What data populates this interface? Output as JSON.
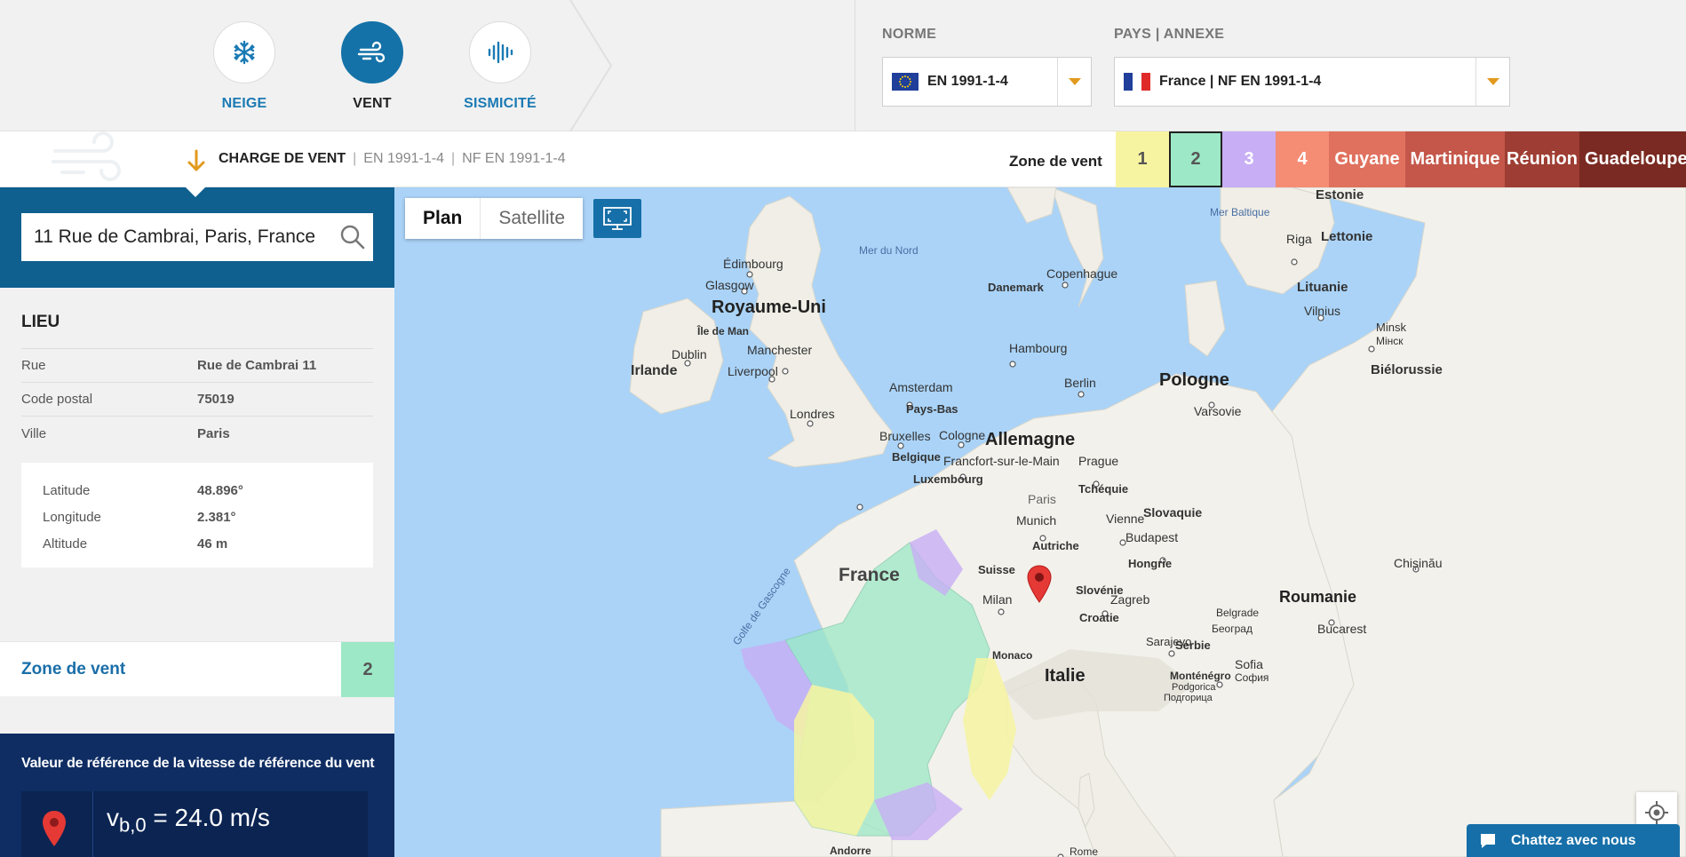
{
  "nav": {
    "loads": [
      {
        "label": "NEIGE",
        "icon": "snowflake-icon",
        "active": false
      },
      {
        "label": "VENT",
        "icon": "wind-icon",
        "active": true
      },
      {
        "label": "SISMICITÉ",
        "icon": "seismic-icon",
        "active": false
      }
    ]
  },
  "selectors": {
    "norme_label": "NORME",
    "norme_value": "EN 1991-1-4",
    "pays_label": "PAYS | ANNEXE",
    "pays_value": "France | NF EN 1991-1-4"
  },
  "breadcrumb": {
    "title": "CHARGE DE VENT",
    "separator": "|",
    "norm": "EN 1991-1-4",
    "annex": "NF EN 1991-1-4"
  },
  "zones": {
    "label": "Zone de vent",
    "selected": "2",
    "items": [
      {
        "label": "1",
        "color": "#f7f4a1",
        "text_color": "#555555"
      },
      {
        "label": "2",
        "color": "#9de8c6",
        "text_color": "#555555"
      },
      {
        "label": "3",
        "color": "#c7aef5",
        "text_color": "#ffffff"
      },
      {
        "label": "4",
        "color": "#f58c74",
        "text_color": "#ffffff"
      },
      {
        "label": "Guyane",
        "color": "#e0715e",
        "text_color": "#ffffff"
      },
      {
        "label": "Martinique",
        "color": "#c4574a",
        "text_color": "#ffffff"
      },
      {
        "label": "Réunion",
        "color": "#9e3d33",
        "text_color": "#ffffff"
      },
      {
        "label": "Guadeloupe",
        "color": "#7a2a22",
        "text_color": "#ffffff"
      }
    ]
  },
  "search": {
    "value": "11 Rue de Cambrai, Paris, France"
  },
  "lieu": {
    "title": "LIEU",
    "rows": [
      {
        "key": "Rue",
        "value": "Rue de Cambrai 11"
      },
      {
        "key": "Code postal",
        "value": "75019"
      },
      {
        "key": "Ville",
        "value": "Paris"
      }
    ],
    "coords": [
      {
        "key": "Latitude",
        "value": "48.896°"
      },
      {
        "key": "Longitude",
        "value": "2.381°"
      },
      {
        "key": "Altitude",
        "value": "46 m"
      }
    ]
  },
  "zone_result": {
    "label": "Zone de vent",
    "value": "2"
  },
  "reference": {
    "title": "Valeur de référence de la vitesse de référence du vent",
    "symbol": "v",
    "subscript": "b,0",
    "equals": "= 24.0 m/s"
  },
  "map": {
    "tabs": [
      "Plan",
      "Satellite"
    ],
    "active_tab": "Plan",
    "labels": [
      {
        "text": "Royaume-Uni",
        "kind": "country"
      },
      {
        "text": "Irlande",
        "kind": "country-small"
      },
      {
        "text": "France",
        "kind": "country-fr"
      },
      {
        "text": "Allemagne",
        "kind": "country"
      },
      {
        "text": "Pologne",
        "kind": "country"
      },
      {
        "text": "Italie",
        "kind": "country"
      },
      {
        "text": "Roumanie",
        "kind": "country"
      },
      {
        "text": "Lituanie",
        "kind": "small"
      },
      {
        "text": "Lettonie",
        "kind": "small"
      },
      {
        "text": "Estonie",
        "kind": "small"
      },
      {
        "text": "Biélorussie",
        "kind": "small"
      },
      {
        "text": "Danemark",
        "kind": "small"
      },
      {
        "text": "Pays-Bas",
        "kind": "small"
      },
      {
        "text": "Belgique",
        "kind": "small"
      },
      {
        "text": "Luxembourg",
        "kind": "small"
      },
      {
        "text": "Tchéquie",
        "kind": "small"
      },
      {
        "text": "Slovaquie",
        "kind": "small"
      },
      {
        "text": "Autriche",
        "kind": "small"
      },
      {
        "text": "Hongrie",
        "kind": "small"
      },
      {
        "text": "Suisse",
        "kind": "small"
      },
      {
        "text": "Slovénie",
        "kind": "small"
      },
      {
        "text": "Croatie",
        "kind": "small"
      },
      {
        "text": "Serbie",
        "kind": "small"
      },
      {
        "text": "Monaco",
        "kind": "small"
      },
      {
        "text": "Andorre",
        "kind": "small"
      },
      {
        "text": "Monténégro",
        "kind": "small"
      },
      {
        "text": "Île de Man",
        "kind": "small"
      },
      {
        "text": "Mer du Nord",
        "kind": "sea"
      },
      {
        "text": "Mer Baltique",
        "kind": "sea"
      },
      {
        "text": "Golfe de Gascogne",
        "kind": "sea"
      },
      {
        "text": "Édimbourg",
        "kind": "city"
      },
      {
        "text": "Glasgow",
        "kind": "city"
      },
      {
        "text": "Dublin",
        "kind": "city"
      },
      {
        "text": "Manchester",
        "kind": "city"
      },
      {
        "text": "Liverpool",
        "kind": "city"
      },
      {
        "text": "Londres",
        "kind": "city"
      },
      {
        "text": "Amsterdam",
        "kind": "city"
      },
      {
        "text": "Bruxelles",
        "kind": "city"
      },
      {
        "text": "Cologne",
        "kind": "city"
      },
      {
        "text": "Francfort-sur-le-Main",
        "kind": "city"
      },
      {
        "text": "Hambourg",
        "kind": "city"
      },
      {
        "text": "Copenhague",
        "kind": "city"
      },
      {
        "text": "Berlin",
        "kind": "city"
      },
      {
        "text": "Varsovie",
        "kind": "city"
      },
      {
        "text": "Prague",
        "kind": "city"
      },
      {
        "text": "Munich",
        "kind": "city"
      },
      {
        "text": "Vienne",
        "kind": "city"
      },
      {
        "text": "Budapest",
        "kind": "city"
      },
      {
        "text": "Milan",
        "kind": "city"
      },
      {
        "text": "Zagreb",
        "kind": "city"
      },
      {
        "text": "Sarajevo",
        "kind": "city"
      },
      {
        "text": "Belgrade",
        "kind": "city"
      },
      {
        "text": "Bucarest",
        "kind": "city"
      },
      {
        "text": "Sofia",
        "kind": "city"
      },
      {
        "text": "Riga",
        "kind": "city"
      },
      {
        "text": "Vilnius",
        "kind": "city"
      },
      {
        "text": "Minsk",
        "kind": "city"
      },
      {
        "text": "Chișinău",
        "kind": "city"
      },
      {
        "text": "Rome",
        "kind": "city"
      },
      {
        "text": "Podgorica",
        "kind": "city"
      },
      {
        "text": "Paris",
        "kind": "city"
      },
      {
        "text": "Београд",
        "kind": "city"
      },
      {
        "text": "Мінск",
        "kind": "city"
      },
      {
        "text": "София",
        "kind": "city"
      },
      {
        "text": "Подгорица",
        "kind": "city"
      }
    ]
  },
  "chat": {
    "label": "Chattez avec nous"
  },
  "colors": {
    "primary": "#1472a8",
    "dark_panel": "#0f2d63",
    "accent": "#e29a1e",
    "water": "#aad3f7",
    "land": "#f4f3ee",
    "marker": "#e53935"
  }
}
